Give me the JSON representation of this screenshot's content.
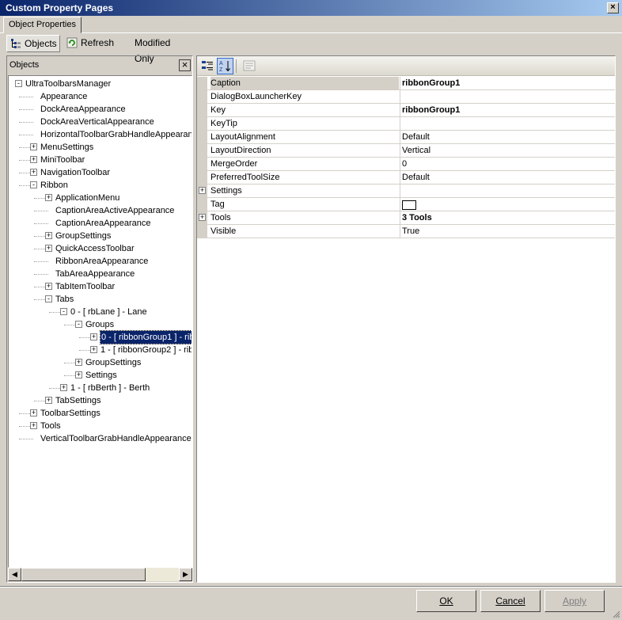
{
  "window": {
    "title": "Custom Property Pages",
    "close": "×"
  },
  "tabs": [
    {
      "label": "Object Properties"
    }
  ],
  "toolbar": {
    "objects_label": "Objects",
    "refresh_label": "Refresh",
    "modified_only_label": "Modified Only"
  },
  "objects_panel": {
    "header": "Objects",
    "close": "×",
    "tree": [
      {
        "label": "UltraToolbarsManager",
        "level": 0,
        "expander": "-"
      },
      {
        "label": "Appearance",
        "level": 1,
        "expander": ""
      },
      {
        "label": "DockAreaAppearance",
        "level": 1,
        "expander": ""
      },
      {
        "label": "DockAreaVerticalAppearance",
        "level": 1,
        "expander": ""
      },
      {
        "label": "HorizontalToolbarGrabHandleAppearance",
        "level": 1,
        "expander": ""
      },
      {
        "label": "MenuSettings",
        "level": 1,
        "expander": "+"
      },
      {
        "label": "MiniToolbar",
        "level": 1,
        "expander": "+"
      },
      {
        "label": "NavigationToolbar",
        "level": 1,
        "expander": "+"
      },
      {
        "label": "Ribbon",
        "level": 1,
        "expander": "-"
      },
      {
        "label": "ApplicationMenu",
        "level": 2,
        "expander": "+"
      },
      {
        "label": "CaptionAreaActiveAppearance",
        "level": 2,
        "expander": ""
      },
      {
        "label": "CaptionAreaAppearance",
        "level": 2,
        "expander": ""
      },
      {
        "label": "GroupSettings",
        "level": 2,
        "expander": "+"
      },
      {
        "label": "QuickAccessToolbar",
        "level": 2,
        "expander": "+"
      },
      {
        "label": "RibbonAreaAppearance",
        "level": 2,
        "expander": ""
      },
      {
        "label": "TabAreaAppearance",
        "level": 2,
        "expander": ""
      },
      {
        "label": "TabItemToolbar",
        "level": 2,
        "expander": "+"
      },
      {
        "label": "Tabs",
        "level": 2,
        "expander": "-"
      },
      {
        "label": "0 - [ rbLane ] - Lane",
        "level": 3,
        "expander": "-"
      },
      {
        "label": "Groups",
        "level": 4,
        "expander": "-"
      },
      {
        "label": "0 - [ ribbonGroup1 ] - rib",
        "level": 5,
        "expander": "+",
        "selected": true
      },
      {
        "label": "1 - [ ribbonGroup2 ] - rib",
        "level": 5,
        "expander": "+"
      },
      {
        "label": "GroupSettings",
        "level": 4,
        "expander": "+"
      },
      {
        "label": "Settings",
        "level": 4,
        "expander": "+"
      },
      {
        "label": "1 - [ rbBerth ] - Berth",
        "level": 3,
        "expander": "+"
      },
      {
        "label": "TabSettings",
        "level": 2,
        "expander": "+"
      },
      {
        "label": "ToolbarSettings",
        "level": 1,
        "expander": "+"
      },
      {
        "label": "Tools",
        "level": 1,
        "expander": "+"
      },
      {
        "label": "VerticalToolbarGrabHandleAppearance",
        "level": 1,
        "expander": ""
      }
    ]
  },
  "scrollbar": {
    "left_arrow": "◀",
    "right_arrow": "▶"
  },
  "property_grid": {
    "rows": [
      {
        "name": "Caption",
        "value": "ribbonGroup1",
        "bold": true,
        "selected": true,
        "expander": "",
        "swatch": false
      },
      {
        "name": "DialogBoxLauncherKey",
        "value": "",
        "bold": false,
        "expander": "",
        "swatch": false
      },
      {
        "name": "Key",
        "value": "ribbonGroup1",
        "bold": true,
        "expander": "",
        "swatch": false
      },
      {
        "name": "KeyTip",
        "value": "",
        "bold": false,
        "expander": "",
        "swatch": false
      },
      {
        "name": "LayoutAlignment",
        "value": "Default",
        "bold": false,
        "expander": "",
        "swatch": false
      },
      {
        "name": "LayoutDirection",
        "value": "Vertical",
        "bold": false,
        "expander": "",
        "swatch": false
      },
      {
        "name": "MergeOrder",
        "value": "0",
        "bold": false,
        "expander": "",
        "swatch": false
      },
      {
        "name": "PreferredToolSize",
        "value": "Default",
        "bold": false,
        "expander": "",
        "swatch": false
      },
      {
        "name": "Settings",
        "value": "",
        "bold": false,
        "expander": "+",
        "swatch": false
      },
      {
        "name": "Tag",
        "value": "",
        "bold": false,
        "expander": "",
        "swatch": true
      },
      {
        "name": "Tools",
        "value": "3 Tools",
        "bold": true,
        "expander": "+",
        "swatch": false
      },
      {
        "name": "Visible",
        "value": "True",
        "bold": false,
        "expander": "",
        "swatch": false
      }
    ]
  },
  "footer": {
    "ok_label": "OK",
    "cancel_label": "Cancel",
    "apply_label": "Apply"
  },
  "colors": {
    "titlebar_start": "#0a246a",
    "titlebar_end": "#a6caf0",
    "selection": "#0a246a",
    "face": "#d4d0c8"
  }
}
